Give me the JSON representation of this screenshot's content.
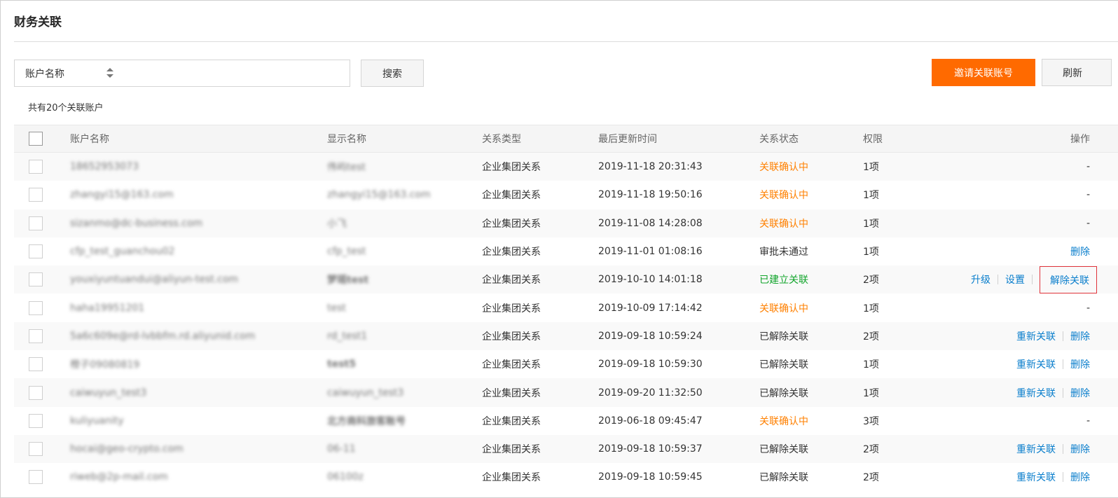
{
  "page": {
    "title": "财务关联"
  },
  "search": {
    "field_label": "账户名称",
    "input_value": "",
    "search_label": "搜索"
  },
  "actions": {
    "invite_label": "邀请关联账号",
    "refresh_label": "刷新"
  },
  "summary": {
    "count_text": "共有20个关联账户"
  },
  "table": {
    "columns": [
      "账户名称",
      "显示名称",
      "关系类型",
      "最后更新时间",
      "关系状态",
      "权限",
      "操作"
    ],
    "rows": [
      {
        "account": "18652953073",
        "display": "伟屿test",
        "type": "企业集团关系",
        "time": "2019-11-18 20:31:43",
        "status": "关联确认中",
        "status_kind": "orange",
        "perm": "1项",
        "ops": [],
        "ops_dash": "-"
      },
      {
        "account": "zhangyi15@163.com",
        "display": "zhangyi15@163.com",
        "type": "企业集团关系",
        "time": "2019-11-18 19:50:16",
        "status": "关联确认中",
        "status_kind": "orange",
        "perm": "1项",
        "ops": [],
        "ops_dash": "-"
      },
      {
        "account": "sizanmo@dc-business.com",
        "display": "小飞",
        "type": "企业集团关系",
        "time": "2019-11-08 14:28:08",
        "status": "关联确认中",
        "status_kind": "orange",
        "perm": "1项",
        "ops": [],
        "ops_dash": "-"
      },
      {
        "account": "cfp_test_guanchou02",
        "display": "cfp_test",
        "type": "企业集团关系",
        "time": "2019-11-01 01:08:16",
        "status": "审批未通过",
        "status_kind": "gray",
        "perm": "1项",
        "ops": [
          "删除"
        ],
        "ops_dash": ""
      },
      {
        "account": "youxiyuntuandui@aliyun-test.com",
        "display": "梦瑶test",
        "type": "企业集团关系",
        "time": "2019-10-10 14:01:18",
        "status": "已建立关联",
        "status_kind": "green",
        "perm": "2项",
        "ops": [
          "升级",
          "设置",
          "解除关联"
        ],
        "ops_dash": ""
      },
      {
        "account": "haha19951201",
        "display": "test",
        "type": "企业集团关系",
        "time": "2019-10-09 17:14:42",
        "status": "关联确认中",
        "status_kind": "orange",
        "perm": "1项",
        "ops": [],
        "ops_dash": "-"
      },
      {
        "account": "5a6c609e@rd-lvbbfm.rd.aliyunid.com",
        "display": "rd_test1",
        "type": "企业集团关系",
        "time": "2019-09-18 10:59:24",
        "status": "已解除关联",
        "status_kind": "gray",
        "perm": "2项",
        "ops": [
          "重新关联",
          "删除"
        ],
        "ops_dash": ""
      },
      {
        "account": "橙子09080819",
        "display": "test5",
        "type": "企业集团关系",
        "time": "2019-09-18 10:59:30",
        "status": "已解除关联",
        "status_kind": "gray",
        "perm": "1项",
        "ops": [
          "重新关联",
          "删除"
        ],
        "ops_dash": ""
      },
      {
        "account": "caiwuyun_test3",
        "display": "caiwuyun_test3",
        "type": "企业集团关系",
        "time": "2019-09-20 11:32:50",
        "status": "已解除关联",
        "status_kind": "gray",
        "perm": "1项",
        "ops": [
          "重新关联",
          "删除"
        ],
        "ops_dash": ""
      },
      {
        "account": "kuliyuanity",
        "display": "北方商科旅客账号",
        "type": "企业集团关系",
        "time": "2019-06-18 09:45:47",
        "status": "关联确认中",
        "status_kind": "orange",
        "perm": "3项",
        "ops": [],
        "ops_dash": "-"
      },
      {
        "account": "hocai@geo-crypto.com",
        "display": "06-11",
        "type": "企业集团关系",
        "time": "2019-09-18 10:59:37",
        "status": "已解除关联",
        "status_kind": "gray",
        "perm": "2项",
        "ops": [
          "重新关联",
          "删除"
        ],
        "ops_dash": ""
      },
      {
        "account": "riweb@2p-mail.com",
        "display": "06100z",
        "type": "企业集团关系",
        "time": "2019-09-18 10:59:45",
        "status": "已解除关联",
        "status_kind": "gray",
        "perm": "2项",
        "ops": [
          "重新关联",
          "删除"
        ],
        "ops_dash": ""
      }
    ]
  },
  "colors": {
    "accent": "#ff6a00",
    "link": "#0a7ecc",
    "pending": "#ff8000",
    "established": "#12a52c",
    "highlight_border": "#e0333a"
  }
}
